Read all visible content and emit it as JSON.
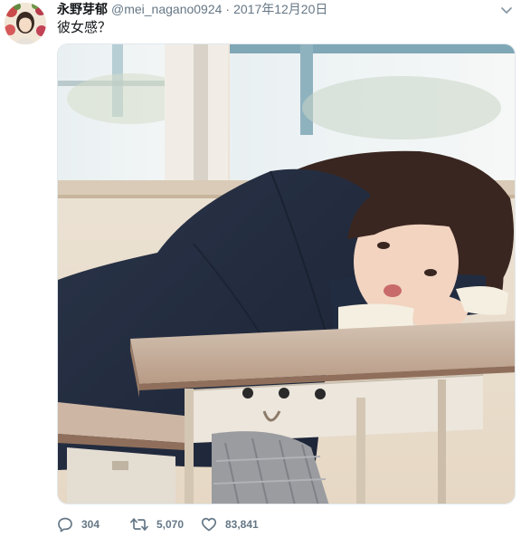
{
  "tweet": {
    "author": {
      "display_name": "永野芽郁",
      "handle": "@mei_nagano0924"
    },
    "separator": "·",
    "date": "2017年12月20日",
    "text": "彼女感？",
    "stats": {
      "replies": "304",
      "retweets": "5,070",
      "likes": "83,841"
    }
  },
  "icons": {
    "caret": "chevron-down-icon",
    "reply": "reply-icon",
    "retweet": "retweet-icon",
    "like": "heart-icon"
  },
  "colors": {
    "text_primary": "#14171a",
    "text_secondary": "#657786"
  }
}
